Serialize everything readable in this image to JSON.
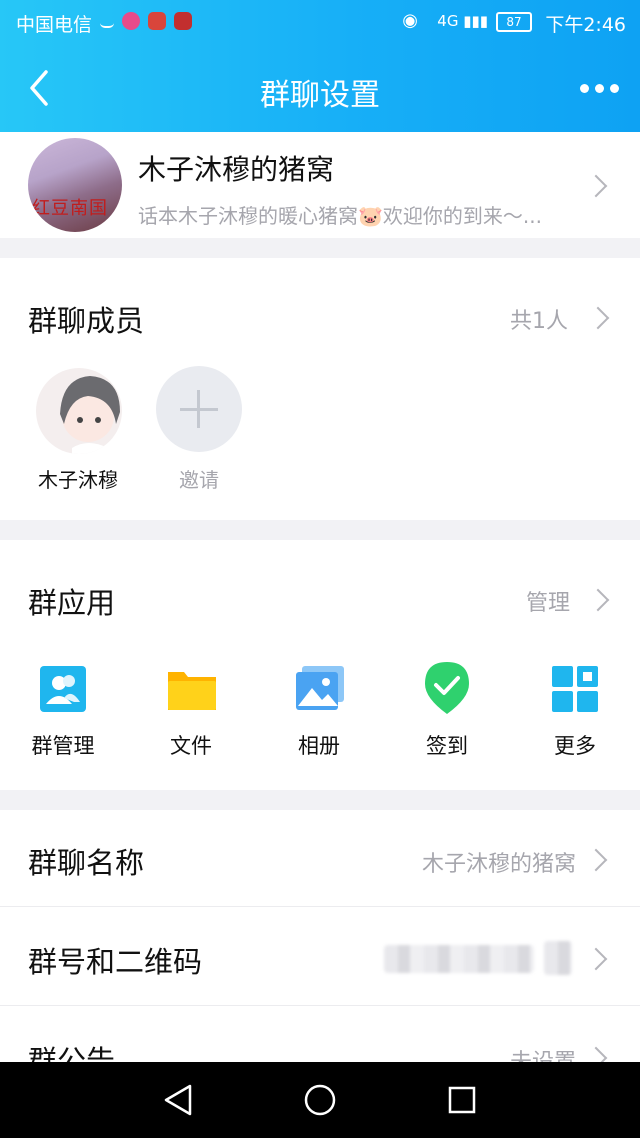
{
  "status_bar": {
    "carrier": "中国电信",
    "battery": "87",
    "network": "4G",
    "time": "下午2:46"
  },
  "header": {
    "title": "群聊设置"
  },
  "group": {
    "name": "木子沐穆的猪窝",
    "description": "话本木子沐穆的暖心猪窝🐷欢迎你的到来～...",
    "avatar_text": "红豆南国"
  },
  "members": {
    "title": "群聊成员",
    "count": "共1人",
    "list": [
      {
        "name": "木子沐穆"
      }
    ],
    "invite_label": "邀请"
  },
  "apps": {
    "title": "群应用",
    "manage_label": "管理",
    "items": [
      {
        "label": "群管理",
        "icon": "group-manage-icon",
        "color": "#1fb6ee"
      },
      {
        "label": "文件",
        "icon": "folder-icon",
        "color": "#ffc400"
      },
      {
        "label": "相册",
        "icon": "album-icon",
        "color": "#4aa3f2"
      },
      {
        "label": "签到",
        "icon": "checkin-icon",
        "color": "#2fd16e"
      },
      {
        "label": "更多",
        "icon": "grid-more-icon",
        "color": "#1fb6ee"
      }
    ]
  },
  "settings": {
    "group_name_label": "群聊名称",
    "group_name_value": "木子沐穆的猪窝",
    "group_id_label": "群号和二维码",
    "announcement_label": "群公告",
    "announcement_value": "未设置"
  }
}
